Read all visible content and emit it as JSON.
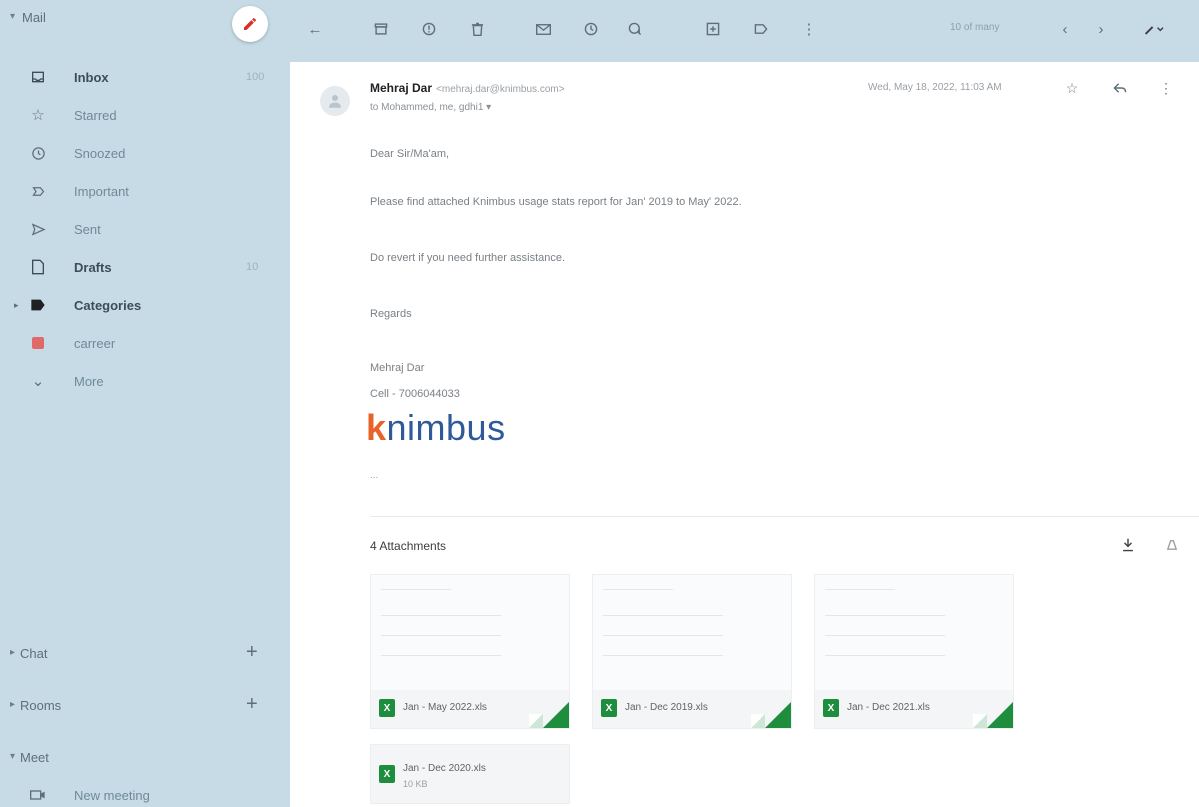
{
  "sidebar": {
    "mail_section": "Mail",
    "items": [
      {
        "icon": "inbox-icon",
        "label": "Inbox",
        "count": "100",
        "bold": true
      },
      {
        "icon": "star-icon",
        "label": "Starred",
        "count": "",
        "bold": false
      },
      {
        "icon": "clock-icon",
        "label": "Snoozed",
        "count": "",
        "bold": false
      },
      {
        "icon": "important-icon",
        "label": "Important",
        "count": "",
        "bold": false
      },
      {
        "icon": "send-icon",
        "label": "Sent",
        "count": "",
        "bold": false
      },
      {
        "icon": "draft-icon",
        "label": "Drafts",
        "count": "10",
        "bold": true
      },
      {
        "icon": "label-icon",
        "label": "Categories",
        "count": "",
        "bold": true
      },
      {
        "icon": "label-red-icon",
        "label": "carreer",
        "count": "",
        "bold": false
      },
      {
        "icon": "chevron-down-icon",
        "label": "More",
        "count": "",
        "bold": false
      }
    ],
    "chat_section": "Chat",
    "rooms_section": "Rooms",
    "meet_section": "Meet",
    "new_meeting": "New meeting"
  },
  "toolbar": {
    "count_text": "10 of many"
  },
  "email": {
    "sender_name": "Mehraj Dar",
    "sender_email": "<mehraj.dar@knimbus.com>",
    "to_line": "to Mohammed, me, gdhi1 ▾",
    "date": "Wed, May 18, 2022, 11:03 AM",
    "greeting": "Dear Sir/Ma'am,",
    "line1": "Please find attached Knimbus usage stats report for Jan' 2019 to May' 2022.",
    "line2": "Do revert if you need further assistance.",
    "regards": "Regards",
    "signature_name": "Mehraj Dar",
    "signature_cell": "Cell - 7006044033",
    "logo_k": "k",
    "logo_rest": "nimbus",
    "ellipsis": "...",
    "attachments_title": "4 Attachments"
  },
  "attachments": [
    {
      "name": "Jan - May 2022.xls",
      "size": ""
    },
    {
      "name": "Jan - Dec 2019.xls",
      "size": ""
    },
    {
      "name": "Jan - Dec 2021.xls",
      "size": ""
    },
    {
      "name": "Jan - Dec 2020.xls",
      "size": "10 KB"
    }
  ],
  "colors": {
    "sidebar_bg": "#c7dbe6",
    "excel_green": "#1e8e3e",
    "logo_orange": "#e8622a",
    "logo_blue": "#2f5a9a",
    "compose_pencil": "#d93025"
  }
}
